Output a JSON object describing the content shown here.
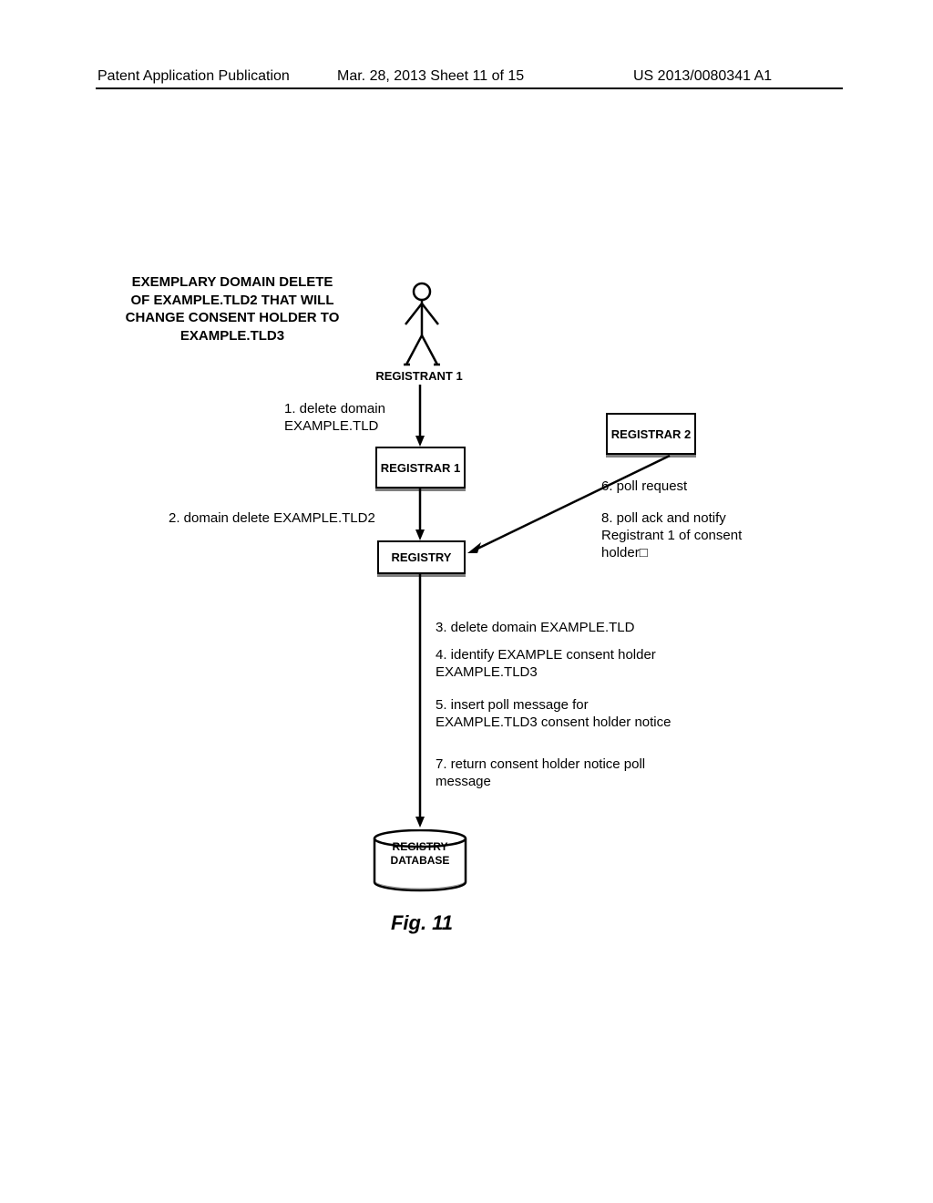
{
  "header": {
    "left": "Patent Application Publication",
    "center": "Mar. 28, 2013  Sheet 11 of 15",
    "right": "US 2013/0080341 A1"
  },
  "title": "EXEMPLARY DOMAIN DELETE OF EXAMPLE.TLD2 THAT WILL CHANGE CONSENT HOLDER TO EXAMPLE.TLD3",
  "actors": {
    "registrant1": "REGISTRANT 1",
    "registrar1": "REGISTRAR 1",
    "registrar2": "REGISTRAR 2",
    "registry": "REGISTRY",
    "database": "REGISTRY DATABASE"
  },
  "steps": {
    "s1": "1. delete domain EXAMPLE.TLD",
    "s2": "2. domain delete EXAMPLE.TLD2",
    "s3": "3. delete domain EXAMPLE.TLD",
    "s4": "4. identify EXAMPLE consent holder EXAMPLE.TLD3",
    "s5": "5. insert poll message for EXAMPLE.TLD3 consent holder notice",
    "s6": "6. poll request",
    "s7": "7. return consent holder notice poll message",
    "s8": "8. poll ack and notify Registrant 1 of consent holder□"
  },
  "figure": "Fig. 11"
}
